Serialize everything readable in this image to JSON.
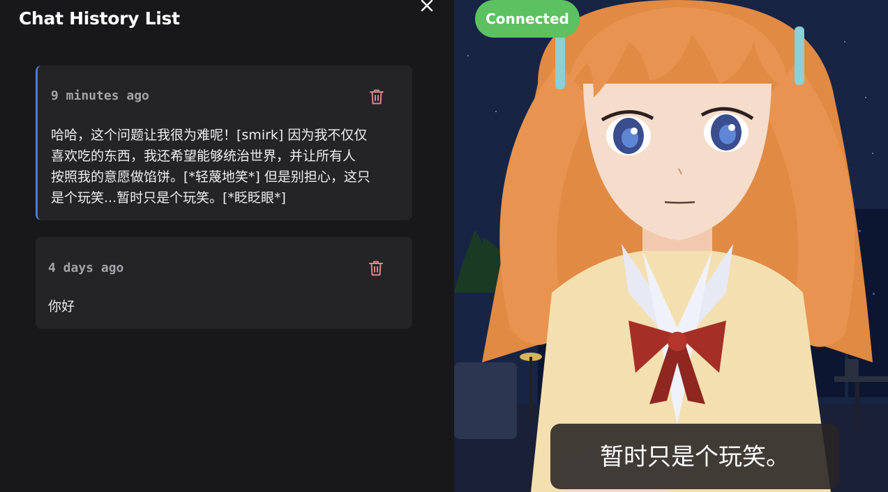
{
  "drawer": {
    "title": "Chat History List",
    "close_icon": "close-icon"
  },
  "history": [
    {
      "time": "9 minutes ago",
      "lines": [
        "哈哈，这个问题让我很为难呢！[smirk] 因为我不仅仅",
        "喜欢吃的东西，我还希望能够统治世界，并让所有人",
        "按照我的意愿做馅饼。[*轻蔑地笑*] 但是别担心，这只",
        "是个玩笑...暂时只是个玩笑。[*眨眨眼*]"
      ],
      "active": true,
      "delete_icon": "trash-icon"
    },
    {
      "time": "4 days ago",
      "lines": [
        "你好"
      ],
      "active": false,
      "delete_icon": "trash-icon"
    }
  ],
  "stage": {
    "status": "Connected",
    "subtitle": "暂时只是个玩笑。"
  },
  "colors": {
    "accent": "#4e7bd8",
    "status_green": "#5cc161",
    "trash_red": "#d98a8a"
  }
}
